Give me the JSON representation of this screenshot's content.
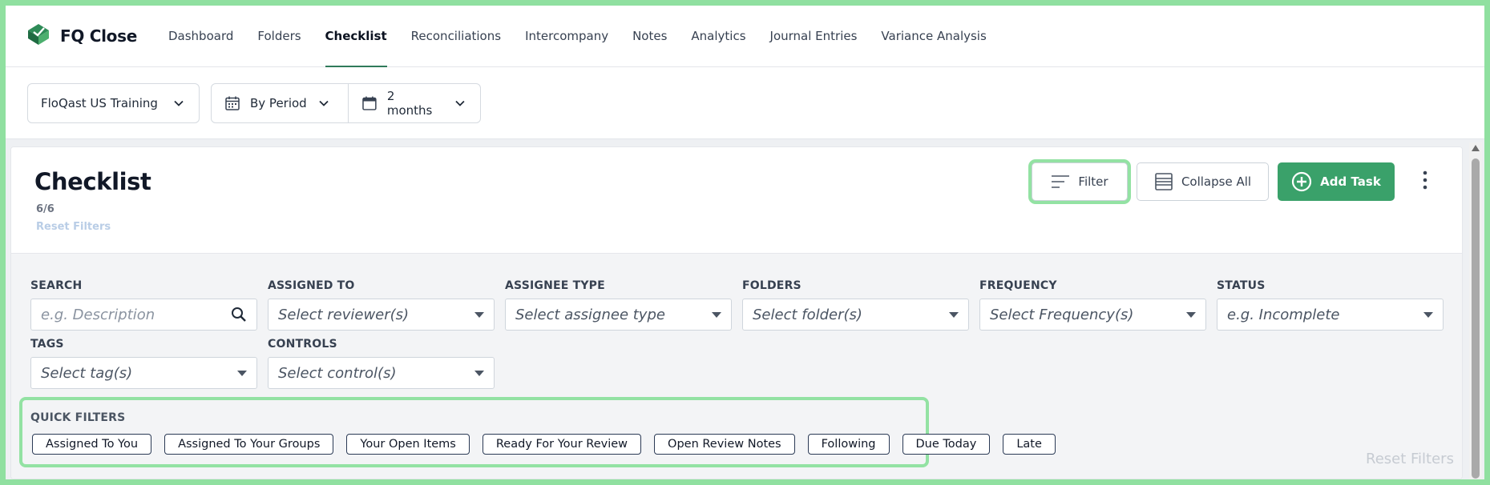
{
  "brand": {
    "name": "FQ Close"
  },
  "nav": {
    "tabs": [
      {
        "label": "Dashboard"
      },
      {
        "label": "Folders"
      },
      {
        "label": "Checklist",
        "active": true
      },
      {
        "label": "Reconciliations"
      },
      {
        "label": "Intercompany"
      },
      {
        "label": "Notes"
      },
      {
        "label": "Analytics"
      },
      {
        "label": "Journal Entries"
      },
      {
        "label": "Variance Analysis"
      }
    ]
  },
  "toolbar": {
    "entity": "FloQast US Training",
    "view": "By Period",
    "range": "2 months"
  },
  "checklist": {
    "title": "Checklist",
    "count": "6/6",
    "reset_filters": "Reset Filters",
    "filter_label": "Filter",
    "collapse_label": "Collapse All",
    "add_task_label": "Add Task"
  },
  "filters": {
    "search": {
      "label": "SEARCH",
      "placeholder": "e.g. Description"
    },
    "assigned_to": {
      "label": "ASSIGNED TO",
      "placeholder": "Select reviewer(s)"
    },
    "assignee_type": {
      "label": "ASSIGNEE TYPE",
      "placeholder": "Select assignee type"
    },
    "folders": {
      "label": "FOLDERS",
      "placeholder": "Select folder(s)"
    },
    "frequency": {
      "label": "FREQUENCY",
      "placeholder": "Select Frequency(s)"
    },
    "status": {
      "label": "STATUS",
      "placeholder": "e.g. Incomplete"
    },
    "tags": {
      "label": "TAGS",
      "placeholder": "Select tag(s)"
    },
    "controls": {
      "label": "CONTROLS",
      "placeholder": "Select control(s)"
    }
  },
  "quick_filters": {
    "label": "QUICK FILTERS",
    "items": [
      "Assigned To You",
      "Assigned To Your Groups",
      "Your Open Items",
      "Ready For Your Review",
      "Open Review Notes",
      "Following",
      "Due Today",
      "Late"
    ],
    "reset_label": "Reset Filters"
  },
  "colors": {
    "accent_green": "#3aa16a",
    "highlight": "#93e2a3",
    "active_tab_underline": "#2f7a5a"
  }
}
